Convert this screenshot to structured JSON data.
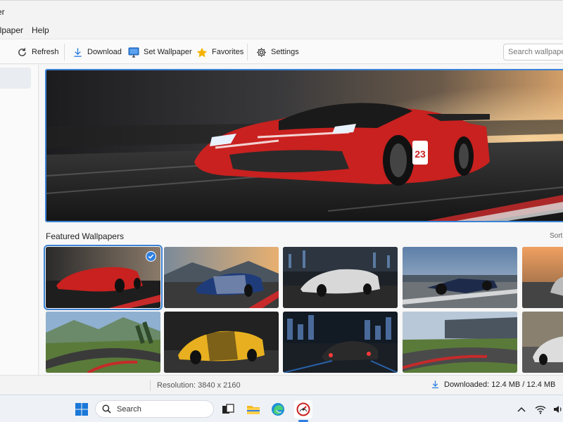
{
  "window": {
    "title": "er"
  },
  "menu": {
    "wallpaper": "llpaper",
    "help": "Help"
  },
  "toolbar": {
    "refresh": "Refresh",
    "download": "Download",
    "set_wallpaper": "Set Wallpaper",
    "favorites": "Favorites",
    "settings": "Settings",
    "search_placeholder": "Search wallpapers"
  },
  "hero": {
    "number": "23"
  },
  "gallery": {
    "title": "Featured Wallpapers",
    "sort": "Sort",
    "selected_index": 0
  },
  "status": {
    "resolution": "Resolution: 3840 x 2160",
    "downloaded": "Downloaded: 12.4 MB / 12.4 MB"
  },
  "taskbar": {
    "search": "Search"
  },
  "colors": {
    "accent": "#2f7fe0",
    "star": "#f5b400",
    "car_red": "#c8211f"
  }
}
